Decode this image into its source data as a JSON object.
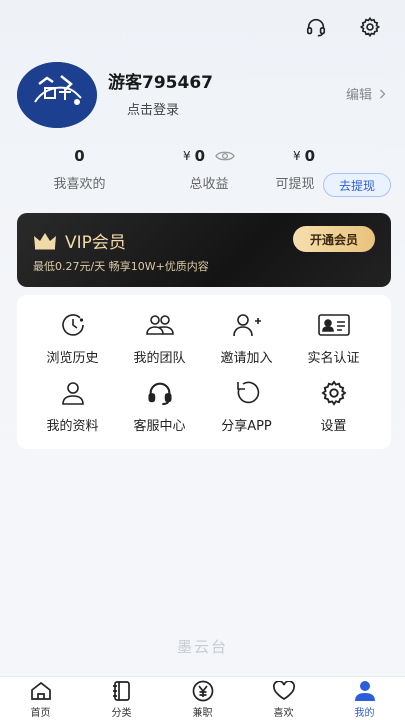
{
  "header": {
    "icons": [
      "headset-icon",
      "gear-icon"
    ]
  },
  "profile": {
    "username": "游客795467",
    "login_text": "点击登录",
    "edit_text": "编辑",
    "avatar_logo_text": "墨云台"
  },
  "stats": [
    {
      "value": "0",
      "label": "我喜欢的",
      "currency": "",
      "eye": false
    },
    {
      "value": "0",
      "label": "总收益",
      "currency": "¥",
      "eye": true
    },
    {
      "value": "0",
      "label": "可提现",
      "currency": "¥",
      "eye": true
    }
  ],
  "withdraw_button": "去提现",
  "vip": {
    "title": "VIP会员",
    "subtitle": "最低0.27元/天 畅享10W+优质内容",
    "open_button": "开通会员"
  },
  "menu": [
    {
      "label": "浏览历史",
      "icon": "clock-icon"
    },
    {
      "label": "我的团队",
      "icon": "team-icon"
    },
    {
      "label": "邀请加入",
      "icon": "add-user-icon"
    },
    {
      "label": "实名认证",
      "icon": "id-card-icon"
    },
    {
      "label": "我的资料",
      "icon": "user-icon"
    },
    {
      "label": "客服中心",
      "icon": "headset-icon"
    },
    {
      "label": "分享APP",
      "icon": "share-icon"
    },
    {
      "label": "设置",
      "icon": "gear-icon"
    }
  ],
  "watermark": "墨云台",
  "tabs": [
    {
      "label": "首页",
      "icon": "home-icon",
      "active": false
    },
    {
      "label": "分类",
      "icon": "category-icon",
      "active": false
    },
    {
      "label": "兼职",
      "icon": "yen-icon",
      "active": false
    },
    {
      "label": "喜欢",
      "icon": "heart-icon",
      "active": false
    },
    {
      "label": "我的",
      "icon": "profile-icon",
      "active": true
    }
  ],
  "colors": {
    "accent": "#2b5fd9",
    "vip_gold": "#f1d9a8",
    "background": "#f3f5f9"
  }
}
